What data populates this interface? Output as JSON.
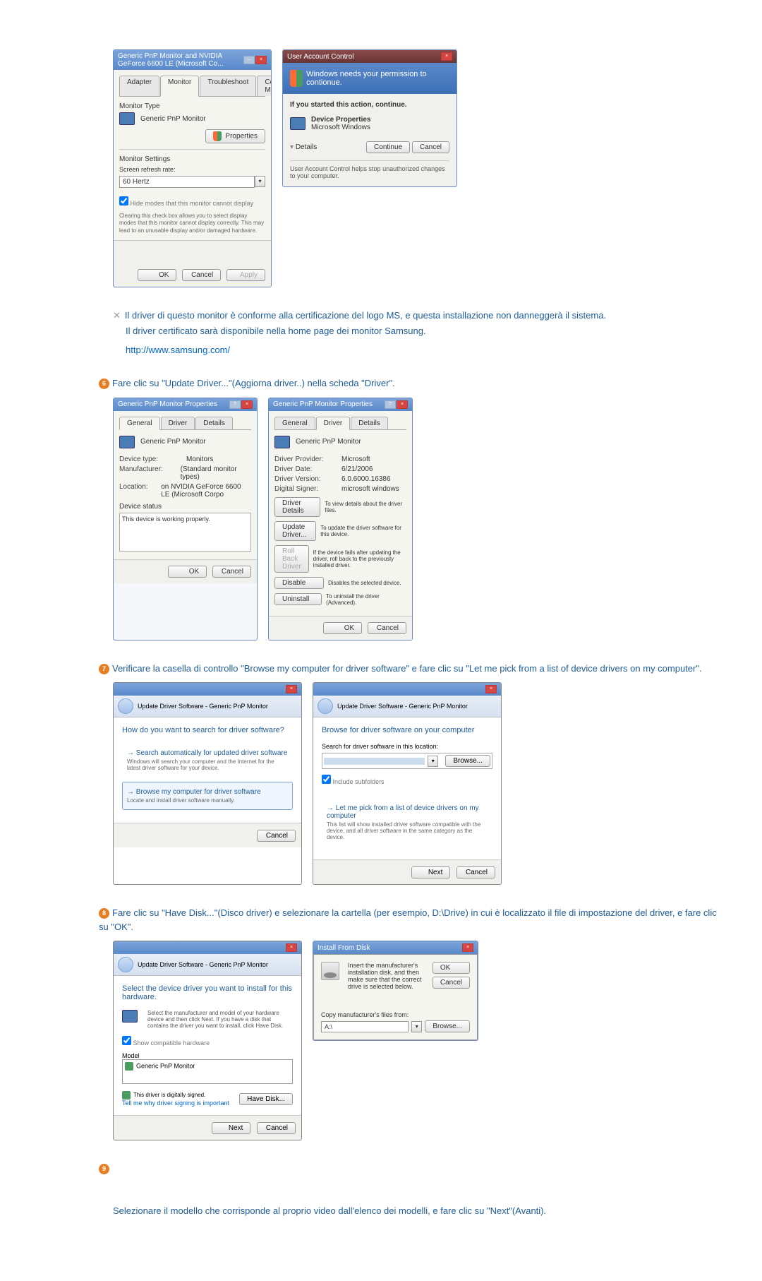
{
  "topDialog": {
    "title": "Generic PnP Monitor and NVIDIA GeForce 6600 LE (Microsoft Co...",
    "tabs": [
      "Adapter",
      "Monitor",
      "Troubleshoot",
      "Color Management"
    ],
    "monitorTypeLabel": "Monitor Type",
    "monitorTypeValue": "Generic PnP Monitor",
    "propertiesBtn": "Properties",
    "settingsLabel": "Monitor Settings",
    "refreshLabel": "Screen refresh rate:",
    "refreshValue": "60 Hertz",
    "hideModesChk": "Hide modes that this monitor cannot display",
    "hideModesDesc": "Clearing this check box allows you to select display modes that this monitor cannot display correctly. This may lead to an unusable display and/or damaged hardware.",
    "ok": "OK",
    "cancel": "Cancel",
    "apply": "Apply"
  },
  "uac": {
    "title": "User Account Control",
    "banner": "Windows needs your permission to contionue.",
    "startedLabel": "If you started this action, continue.",
    "programName": "Device Properties",
    "publisher": "Microsoft Windows",
    "details": "Details",
    "continue": "Continue",
    "cancel": "Cancel",
    "footer": "User Account Control helps stop unauthorized changes to your computer."
  },
  "note": {
    "line1": "Il driver di questo monitor è conforme alla certificazione del logo MS, e questa installazione non danneggerà il sistema.",
    "line2": "Il driver certificato sarà disponibile nella home page dei monitor Samsung.",
    "url": "http://www.samsung.com/"
  },
  "step6": {
    "text": "Fare clic su \"Update Driver...\"(Aggiorna driver..) nella scheda \"Driver\"."
  },
  "propsGeneral": {
    "title": "Generic PnP Monitor Properties",
    "tabs": [
      "General",
      "Driver",
      "Details"
    ],
    "name": "Generic PnP Monitor",
    "deviceType": "Device type:",
    "deviceTypeVal": "Monitors",
    "manufacturer": "Manufacturer:",
    "manufacturerVal": "(Standard monitor types)",
    "location": "Location:",
    "locationVal": "on NVIDIA GeForce 6600 LE (Microsoft Corpo",
    "statusLabel": "Device status",
    "statusText": "This device is working properly.",
    "ok": "OK",
    "cancel": "Cancel"
  },
  "propsDriver": {
    "title": "Generic PnP Monitor Properties",
    "tabs": [
      "General",
      "Driver",
      "Details"
    ],
    "name": "Generic PnP Monitor",
    "provider": "Driver Provider:",
    "providerVal": "Microsoft",
    "date": "Driver Date:",
    "dateVal": "6/21/2006",
    "version": "Driver Version:",
    "versionVal": "6.0.6000.16386",
    "signer": "Digital Signer:",
    "signerVal": "microsoft windows",
    "detailsBtn": "Driver Details",
    "detailsDesc": "To view details about the driver files.",
    "updateBtn": "Update Driver...",
    "updateDesc": "To update the driver software for this device.",
    "rollbackBtn": "Roll Back Driver",
    "rollbackDesc": "If the device fails after updating the driver, roll back to the previously installed driver.",
    "disableBtn": "Disable",
    "disableDesc": "Disables the selected device.",
    "uninstallBtn": "Uninstall",
    "uninstallDesc": "To uninstall the driver (Advanced).",
    "ok": "OK",
    "cancel": "Cancel"
  },
  "step7": {
    "text": "Verificare la casella di controllo \"Browse my computer for driver software\" e fare clic su \"Let me pick from a list of device drivers on my computer\"."
  },
  "wizard1": {
    "breadcrumb": "Update Driver Software - Generic PnP Monitor",
    "heading": "How do you want to search for driver software?",
    "opt1Title": "Search automatically for updated driver software",
    "opt1Desc": "Windows will search your computer and the Internet for the latest driver software for your device.",
    "opt2Title": "Browse my computer for driver software",
    "opt2Desc": "Locate and install driver software manually.",
    "cancel": "Cancel"
  },
  "wizard2": {
    "breadcrumb": "Update Driver Software - Generic PnP Monitor",
    "heading": "Browse for driver software on your computer",
    "searchLabel": "Search for driver software in this location:",
    "browseBtn": "Browse...",
    "includeSub": "Include subfolders",
    "pickTitle": "Let me pick from a list of device drivers on my computer",
    "pickDesc": "This list will show installed driver software compatible with the device, and all driver software in the same category as the device.",
    "next": "Next",
    "cancel": "Cancel"
  },
  "step8": {
    "text": "Fare clic su \"Have Disk...\"(Disco driver) e selezionare la cartella (per esempio, D:\\Drive) in cui è localizzato il file di impostazione del driver, e fare clic su \"OK\"."
  },
  "wizard3": {
    "breadcrumb": "Update Driver Software - Generic PnP Monitor",
    "heading": "Select the device driver you want to install for this hardware.",
    "desc": "Select the manufacturer and model of your hardware device and then click Next. If you have a disk that contains the driver you want to install, click Have Disk.",
    "compatChk": "Show compatible hardware",
    "modelLabel": "Model",
    "modelItem": "Generic PnP Monitor",
    "signed": "This driver is digitally signed.",
    "signedLink": "Tell me why driver signing is important",
    "haveDisk": "Have Disk...",
    "next": "Next",
    "cancel": "Cancel"
  },
  "installDisk": {
    "title": "Install From Disk",
    "text": "Insert the manufacturer's installation disk, and then make sure that the correct drive is selected below.",
    "ok": "OK",
    "cancel": "Cancel",
    "copyLabel": "Copy manufacturer's files from:",
    "pathValue": "A:\\",
    "browse": "Browse..."
  },
  "step9": {
    "text": "Selezionare il modello che corrisponde al proprio video dall'elenco dei modelli, e fare clic su \"Next\"(Avanti)."
  }
}
